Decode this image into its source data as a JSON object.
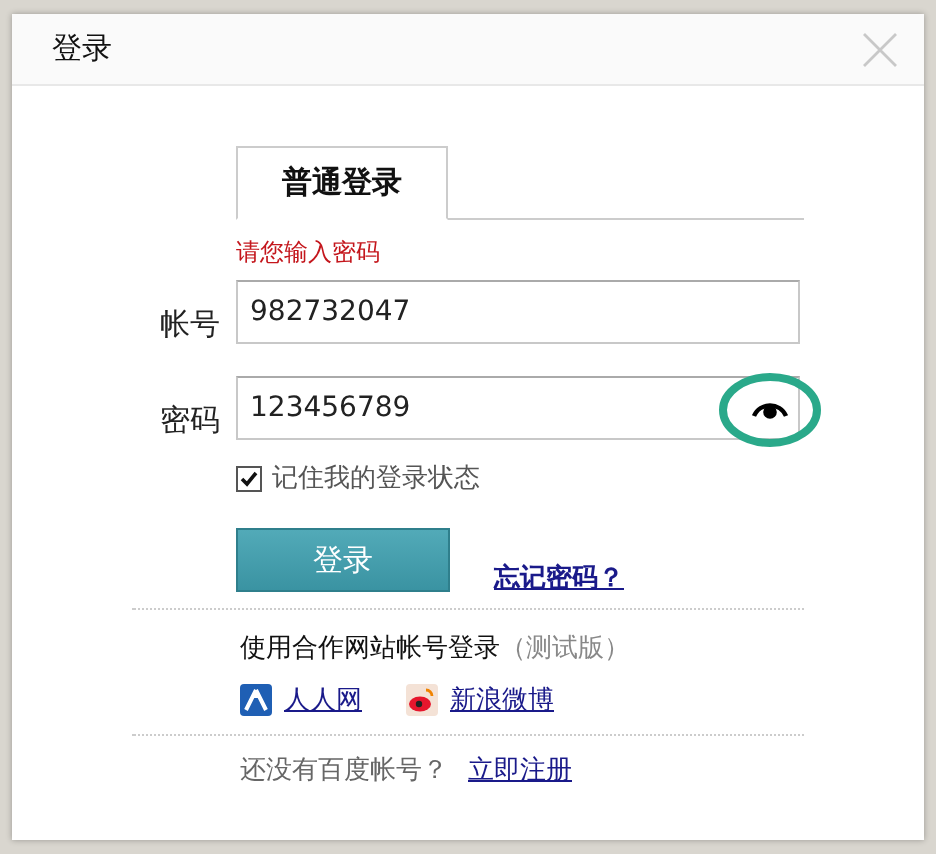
{
  "dialog": {
    "title": "登录",
    "tabs": [
      {
        "label": "普通登录",
        "selected": true
      }
    ],
    "error": "请您输入密码",
    "fields": [
      {
        "label": "帐号",
        "value": "982732047",
        "kind": "text"
      },
      {
        "label": "密码",
        "value": "123456789",
        "kind": "password-shown"
      }
    ],
    "remember": {
      "label": "记住我的登录状态",
      "checked": true
    },
    "login_button": "登录",
    "forgot_link": "忘记密码？",
    "partner": {
      "heading": "使用合作网站帐号登录",
      "note": "（测试版）",
      "links": [
        {
          "label": "人人网",
          "kind": "renren"
        },
        {
          "label": "新浪微博",
          "kind": "weibo"
        }
      ]
    },
    "register": {
      "prompt": "还没有百度帐号？",
      "link": "立即注册"
    }
  }
}
